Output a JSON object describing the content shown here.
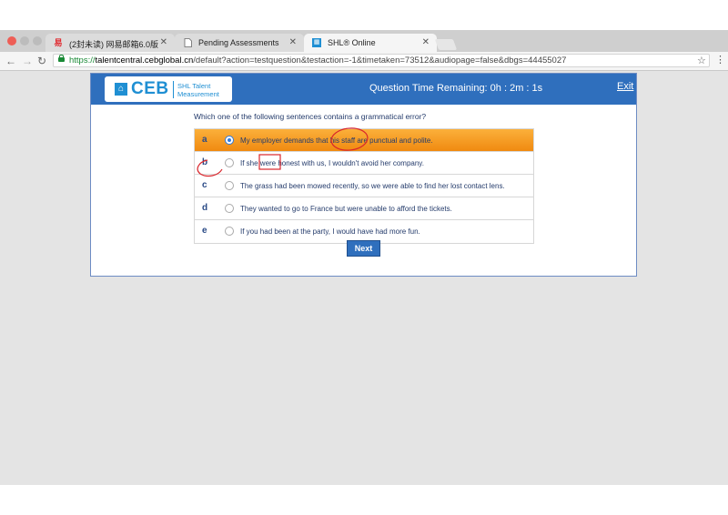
{
  "browser": {
    "tabs": [
      {
        "title": "(2封未读) 网易邮箱6.0版",
        "icon": "netease-mail-icon",
        "active": false
      },
      {
        "title": "Pending Assessments",
        "icon": "document-icon",
        "active": false
      },
      {
        "title": "SHL® Online",
        "icon": "shl-icon",
        "active": true
      }
    ],
    "url": {
      "scheme": "https://",
      "host": "talentcentral.cebglobal.cn",
      "rest": "/default?action=testquestion&testaction=-1&timetaken=73512&audiopage=false&dbgs=44455027"
    }
  },
  "header": {
    "logo_text": "CEB",
    "logo_subtitle_line1": "SHL Talent",
    "logo_subtitle_line2": "Measurement",
    "timer": "Question Time Remaining: 0h : 2m : 1s",
    "exit_label": "Exit"
  },
  "question": {
    "text": "Which one of the following sentences contains a grammatical error?",
    "options": [
      {
        "letter": "a",
        "text": "My employer demands that his staff are punctual and polite.",
        "selected": true
      },
      {
        "letter": "b",
        "text": "If she were honest with us, I wouldn't avoid her company.",
        "selected": false
      },
      {
        "letter": "c",
        "text": "The grass had been mowed recently, so we were able to find her lost contact lens.",
        "selected": false
      },
      {
        "letter": "d",
        "text": "They wanted to go to France but were unable to afford the tickets.",
        "selected": false
      },
      {
        "letter": "e",
        "text": "If you had been at the party, I would have had more fun.",
        "selected": false
      }
    ]
  },
  "next_label": "Next",
  "colors": {
    "header": "#2f6fbd",
    "selected_row": "#f7a12a",
    "annotation": "#d9262c"
  }
}
